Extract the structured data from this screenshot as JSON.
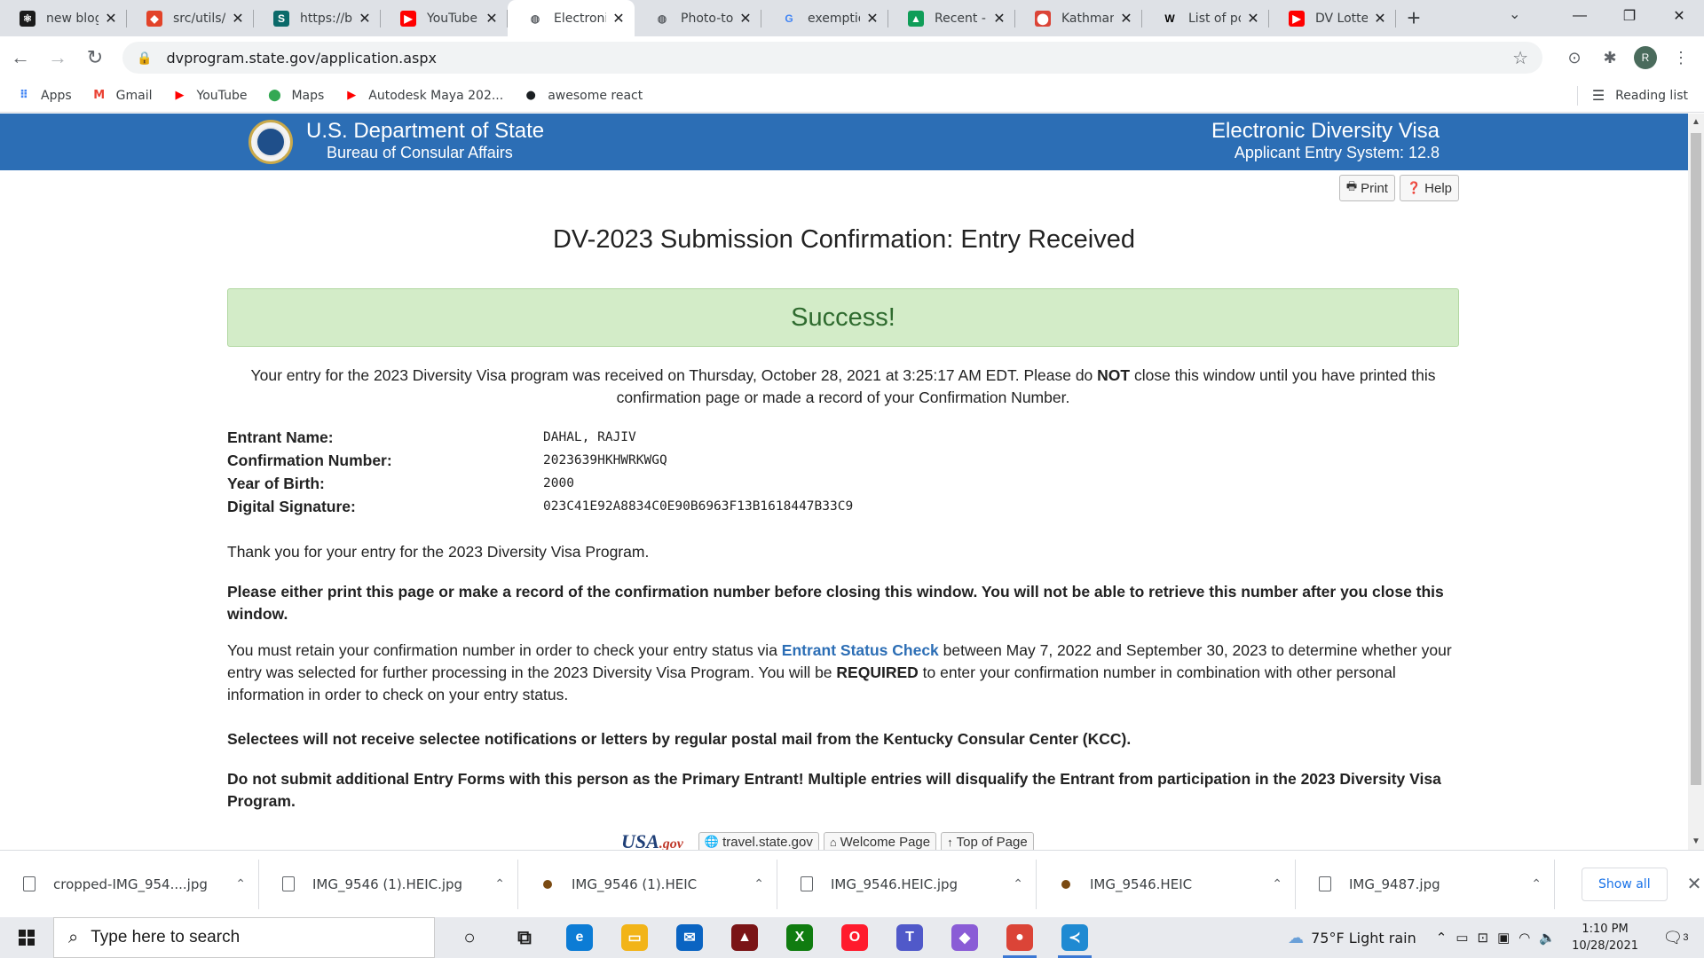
{
  "browser": {
    "tabs": [
      {
        "title": "new blog",
        "favicon": "react-icon",
        "color": "#1b1b1b",
        "active": false
      },
      {
        "title": "src/utils/f",
        "favicon": "gitlab-icon",
        "color": "#e24329",
        "active": false
      },
      {
        "title": "https://br",
        "favicon": "sharepoint-icon",
        "color": "#0b6a6a",
        "active": false
      },
      {
        "title": "YouTube",
        "favicon": "youtube-icon",
        "color": "#ff0000",
        "active": false
      },
      {
        "title": "Electronic",
        "favicon": "globe-icon",
        "color": "#5f6368",
        "active": true
      },
      {
        "title": "Photo-to",
        "favicon": "globe-icon",
        "color": "#5f6368",
        "active": false
      },
      {
        "title": "exemptio",
        "favicon": "google-icon",
        "color": "#4285f4",
        "active": false
      },
      {
        "title": "Recent - ",
        "favicon": "drive-icon",
        "color": "#0f9d58",
        "active": false
      },
      {
        "title": "Kathmand",
        "favicon": "maps-pin-icon",
        "color": "#db4437",
        "active": false
      },
      {
        "title": "List of po",
        "favicon": "wikipedia-icon",
        "color": "#000000",
        "active": false
      },
      {
        "title": "DV Lotter",
        "favicon": "youtube-icon",
        "color": "#ff0000",
        "active": false
      }
    ],
    "url": "dvprogram.state.gov/application.aspx",
    "bookmarks": [
      {
        "label": "Apps",
        "icon": "apps-grid-icon"
      },
      {
        "label": "Gmail",
        "icon": "gmail-icon"
      },
      {
        "label": "YouTube",
        "icon": "youtube-icon"
      },
      {
        "label": "Maps",
        "icon": "maps-pin-icon"
      },
      {
        "label": "Autodesk Maya 202...",
        "icon": "youtube-icon"
      },
      {
        "label": "awesome react",
        "icon": "github-icon"
      }
    ],
    "reading_list": "Reading list"
  },
  "page": {
    "header": {
      "dept": "U.S. Department of State",
      "bureau": "Bureau of Consular Affairs",
      "system_title": "Electronic Diversity Visa",
      "system_subtitle": "Applicant Entry System: 12.8"
    },
    "buttons": {
      "print": "Print",
      "help": "Help"
    },
    "heading": "DV-2023 Submission Confirmation: Entry Received",
    "success": "Success!",
    "intro_pre": "Your entry for the 2023 Diversity Visa program was received on Thursday, October 28, 2021 at 3:25:17 AM EDT. Please do ",
    "intro_bold": "NOT",
    "intro_post": " close this window until you have printed this confirmation page or made a record of your Confirmation Number.",
    "entrant": [
      {
        "label": "Entrant Name:",
        "value": "DAHAL, RAJIV"
      },
      {
        "label": "Confirmation Number:",
        "value": "2023639HKHWRKWGQ"
      },
      {
        "label": "Year of Birth:",
        "value": "2000"
      },
      {
        "label": "Digital Signature:",
        "value": "023C41E92A8834C0E90B6963F13B1618447B33C9"
      }
    ],
    "thanks": "Thank you for your entry for the 2023 Diversity Visa Program.",
    "warning": "Please either print this page or make a record of the confirmation number before closing this window. You will not be able to retrieve this number after you close this window.",
    "retain_pre": "You must retain your confirmation number in order to check your entry status via ",
    "retain_link": "Entrant Status Check",
    "retain_mid": " between May 7, 2022 and September 30, 2023 to determine whether your entry was selected for further processing in the 2023 Diversity Visa Program. You will be ",
    "retain_bold": "REQUIRED",
    "retain_post": " to enter your confirmation number in combination with other personal information in order to check on your entry status.",
    "selectees": "Selectees will not receive selectee notifications or letters by regular postal mail from the Kentucky Consular Center (KCC).",
    "no_submit": "Do not submit additional Entry Forms with this person as the Primary Entrant! Multiple entries will disqualify the Entrant from participation in the 2023 Diversity Visa Program.",
    "footer": {
      "usagov_main": "USA",
      "usagov_suffix": ".gov",
      "links": [
        "travel.state.gov",
        "Welcome Page",
        "Top of Page"
      ]
    }
  },
  "downloads": {
    "files": [
      {
        "name": "cropped-IMG_954....jpg",
        "type": "jpg"
      },
      {
        "name": "IMG_9546 (1).HEIC.jpg",
        "type": "jpg"
      },
      {
        "name": "IMG_9546 (1).HEIC",
        "type": "heic"
      },
      {
        "name": "IMG_9546.HEIC.jpg",
        "type": "jpg"
      },
      {
        "name": "IMG_9546.HEIC",
        "type": "heic"
      },
      {
        "name": "IMG_9487.jpg",
        "type": "jpg"
      }
    ],
    "show_all": "Show all"
  },
  "taskbar": {
    "search_placeholder": "Type here to search",
    "apps": [
      {
        "name": "cortana-icon",
        "color": "transparent",
        "glyph": "○",
        "running": false
      },
      {
        "name": "task-view-icon",
        "color": "transparent",
        "glyph": "⧉",
        "running": false
      },
      {
        "name": "edge-icon",
        "color": "#0c7cd5",
        "glyph": "e",
        "running": false
      },
      {
        "name": "file-explorer-icon",
        "color": "#f2b418",
        "glyph": "▭",
        "running": false
      },
      {
        "name": "mail-icon",
        "color": "#0a64c2",
        "glyph": "✉",
        "running": false
      },
      {
        "name": "game-app-icon",
        "color": "#7a1416",
        "glyph": "▲",
        "running": false
      },
      {
        "name": "xbox-icon",
        "color": "#107c10",
        "glyph": "X",
        "running": false
      },
      {
        "name": "opera-icon",
        "color": "#ff1b2d",
        "glyph": "O",
        "running": false
      },
      {
        "name": "teams-icon",
        "color": "#5059c9",
        "glyph": "T",
        "running": false
      },
      {
        "name": "app-diamond-icon",
        "color": "#8a5cd6",
        "glyph": "◆",
        "running": false
      },
      {
        "name": "chrome-icon",
        "color": "#db4437",
        "glyph": "●",
        "running": true
      },
      {
        "name": "vscode-icon",
        "color": "#1f8ad2",
        "glyph": "≺",
        "running": true
      }
    ],
    "weather": "75°F  Light rain",
    "time": "1:10 PM",
    "date": "10/28/2021",
    "notifications": "3"
  }
}
